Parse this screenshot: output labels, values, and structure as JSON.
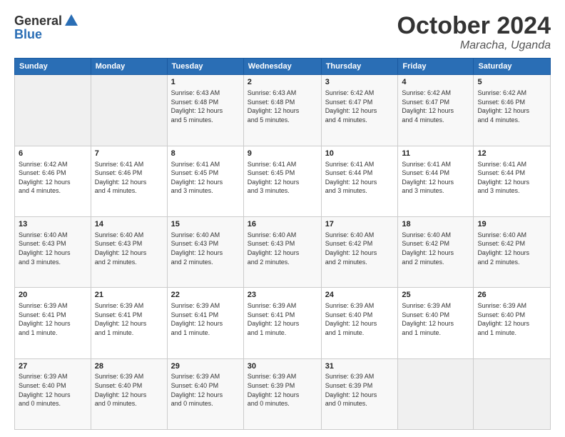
{
  "header": {
    "logo_general": "General",
    "logo_blue": "Blue",
    "month_title": "October 2024",
    "location": "Maracha, Uganda"
  },
  "weekdays": [
    "Sunday",
    "Monday",
    "Tuesday",
    "Wednesday",
    "Thursday",
    "Friday",
    "Saturday"
  ],
  "weeks": [
    [
      {
        "day": "",
        "info": ""
      },
      {
        "day": "",
        "info": ""
      },
      {
        "day": "1",
        "info": "Sunrise: 6:43 AM\nSunset: 6:48 PM\nDaylight: 12 hours\nand 5 minutes."
      },
      {
        "day": "2",
        "info": "Sunrise: 6:43 AM\nSunset: 6:48 PM\nDaylight: 12 hours\nand 5 minutes."
      },
      {
        "day": "3",
        "info": "Sunrise: 6:42 AM\nSunset: 6:47 PM\nDaylight: 12 hours\nand 4 minutes."
      },
      {
        "day": "4",
        "info": "Sunrise: 6:42 AM\nSunset: 6:47 PM\nDaylight: 12 hours\nand 4 minutes."
      },
      {
        "day": "5",
        "info": "Sunrise: 6:42 AM\nSunset: 6:46 PM\nDaylight: 12 hours\nand 4 minutes."
      }
    ],
    [
      {
        "day": "6",
        "info": "Sunrise: 6:42 AM\nSunset: 6:46 PM\nDaylight: 12 hours\nand 4 minutes."
      },
      {
        "day": "7",
        "info": "Sunrise: 6:41 AM\nSunset: 6:46 PM\nDaylight: 12 hours\nand 4 minutes."
      },
      {
        "day": "8",
        "info": "Sunrise: 6:41 AM\nSunset: 6:45 PM\nDaylight: 12 hours\nand 3 minutes."
      },
      {
        "day": "9",
        "info": "Sunrise: 6:41 AM\nSunset: 6:45 PM\nDaylight: 12 hours\nand 3 minutes."
      },
      {
        "day": "10",
        "info": "Sunrise: 6:41 AM\nSunset: 6:44 PM\nDaylight: 12 hours\nand 3 minutes."
      },
      {
        "day": "11",
        "info": "Sunrise: 6:41 AM\nSunset: 6:44 PM\nDaylight: 12 hours\nand 3 minutes."
      },
      {
        "day": "12",
        "info": "Sunrise: 6:41 AM\nSunset: 6:44 PM\nDaylight: 12 hours\nand 3 minutes."
      }
    ],
    [
      {
        "day": "13",
        "info": "Sunrise: 6:40 AM\nSunset: 6:43 PM\nDaylight: 12 hours\nand 3 minutes."
      },
      {
        "day": "14",
        "info": "Sunrise: 6:40 AM\nSunset: 6:43 PM\nDaylight: 12 hours\nand 2 minutes."
      },
      {
        "day": "15",
        "info": "Sunrise: 6:40 AM\nSunset: 6:43 PM\nDaylight: 12 hours\nand 2 minutes."
      },
      {
        "day": "16",
        "info": "Sunrise: 6:40 AM\nSunset: 6:43 PM\nDaylight: 12 hours\nand 2 minutes."
      },
      {
        "day": "17",
        "info": "Sunrise: 6:40 AM\nSunset: 6:42 PM\nDaylight: 12 hours\nand 2 minutes."
      },
      {
        "day": "18",
        "info": "Sunrise: 6:40 AM\nSunset: 6:42 PM\nDaylight: 12 hours\nand 2 minutes."
      },
      {
        "day": "19",
        "info": "Sunrise: 6:40 AM\nSunset: 6:42 PM\nDaylight: 12 hours\nand 2 minutes."
      }
    ],
    [
      {
        "day": "20",
        "info": "Sunrise: 6:39 AM\nSunset: 6:41 PM\nDaylight: 12 hours\nand 1 minute."
      },
      {
        "day": "21",
        "info": "Sunrise: 6:39 AM\nSunset: 6:41 PM\nDaylight: 12 hours\nand 1 minute."
      },
      {
        "day": "22",
        "info": "Sunrise: 6:39 AM\nSunset: 6:41 PM\nDaylight: 12 hours\nand 1 minute."
      },
      {
        "day": "23",
        "info": "Sunrise: 6:39 AM\nSunset: 6:41 PM\nDaylight: 12 hours\nand 1 minute."
      },
      {
        "day": "24",
        "info": "Sunrise: 6:39 AM\nSunset: 6:40 PM\nDaylight: 12 hours\nand 1 minute."
      },
      {
        "day": "25",
        "info": "Sunrise: 6:39 AM\nSunset: 6:40 PM\nDaylight: 12 hours\nand 1 minute."
      },
      {
        "day": "26",
        "info": "Sunrise: 6:39 AM\nSunset: 6:40 PM\nDaylight: 12 hours\nand 1 minute."
      }
    ],
    [
      {
        "day": "27",
        "info": "Sunrise: 6:39 AM\nSunset: 6:40 PM\nDaylight: 12 hours\nand 0 minutes."
      },
      {
        "day": "28",
        "info": "Sunrise: 6:39 AM\nSunset: 6:40 PM\nDaylight: 12 hours\nand 0 minutes."
      },
      {
        "day": "29",
        "info": "Sunrise: 6:39 AM\nSunset: 6:40 PM\nDaylight: 12 hours\nand 0 minutes."
      },
      {
        "day": "30",
        "info": "Sunrise: 6:39 AM\nSunset: 6:39 PM\nDaylight: 12 hours\nand 0 minutes."
      },
      {
        "day": "31",
        "info": "Sunrise: 6:39 AM\nSunset: 6:39 PM\nDaylight: 12 hours\nand 0 minutes."
      },
      {
        "day": "",
        "info": ""
      },
      {
        "day": "",
        "info": ""
      }
    ]
  ]
}
